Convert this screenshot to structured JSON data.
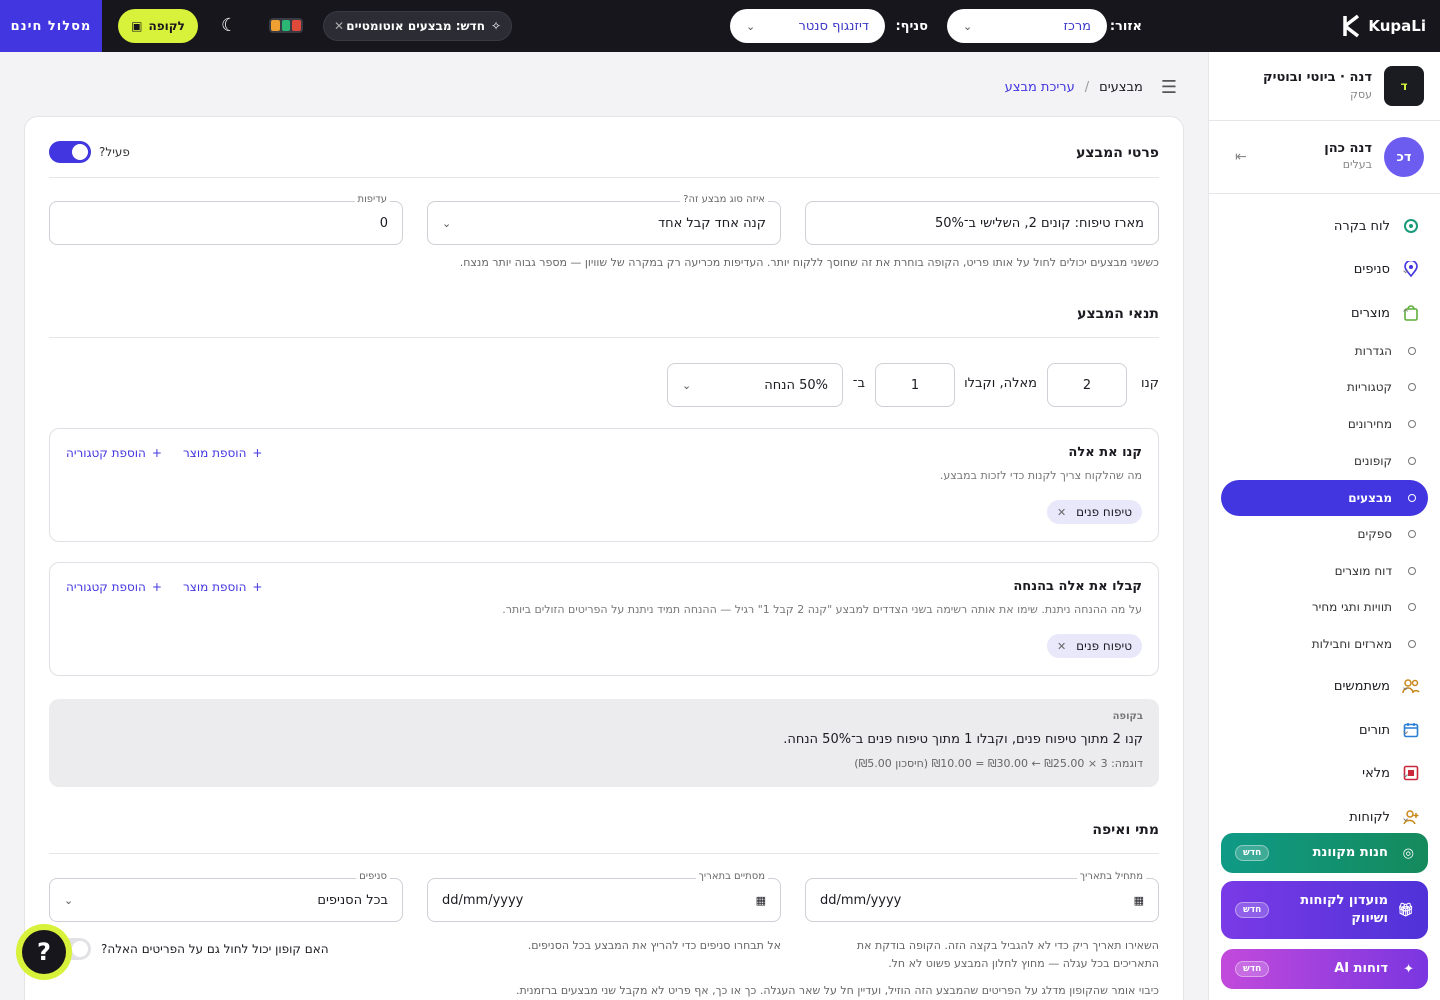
{
  "topbar": {
    "logo": "KupaLi",
    "area_label": "אזור:",
    "area_value": "מרכז",
    "branch_label": "סניף:",
    "branch_value": "דיזנגוף סנטר",
    "new_chip": "חדש: מבצעים אוטומטיים",
    "register_button": "לקופה",
    "free_route": "מסלול חינם",
    "theme_colors": [
      "#e04a3a",
      "#2bb673",
      "#f0a030"
    ]
  },
  "sidebar": {
    "business_avatar": "ד",
    "business_name": "דנה · ביוטי ובוטיק",
    "business_role": "עסק",
    "user_avatar": "דכ",
    "user_name": "דנה כהן",
    "user_role": "בעלים",
    "nav": [
      {
        "label": "לוח בקרה",
        "icon": "dashboard-icon"
      },
      {
        "label": "סניפים",
        "icon": "location-pin-icon"
      },
      {
        "label": "מוצרים",
        "icon": "shopping-bag-icon"
      },
      {
        "label": "משתמשים",
        "icon": "users-icon"
      },
      {
        "label": "תורים",
        "icon": "calendar-icon"
      },
      {
        "label": "מלאי",
        "icon": "inventory-icon"
      },
      {
        "label": "לקוחות",
        "icon": "customers-icon"
      }
    ],
    "products_sub": [
      "הגדרות",
      "קטגוריות",
      "מחירונים",
      "קופונים",
      "מבצעים",
      "ספקים",
      "דוח מוצרים",
      "תוויות ותגי מחיר",
      "מארזים וחבילות"
    ],
    "promos": [
      {
        "label": "חנות מקוונת",
        "badge": "חדש"
      },
      {
        "label": "מועדון לקוחות ושיווק",
        "badge": "חדש"
      },
      {
        "label": "דוחות AI",
        "badge": "חדש"
      }
    ]
  },
  "breadcrumb": {
    "root": "מבצעים",
    "separator": "/",
    "current": "עריכת מבצע"
  },
  "details": {
    "title": "פרטי המבצע",
    "active_label": "פעיל?",
    "name_value": "מארז טיפוח: קונים 2, השלישי ב־50%",
    "type_label": "איזה סוג מבצע זה?",
    "type_value": "קנה אחד קבל אחד",
    "priority_label": "עדיפות",
    "priority_value": "0",
    "help": "כששני מבצעים יכולים לחול על אותו פריט, הקופה בוחרת את זה שחוסך ללקוח יותר. העדיפות מכריעה רק במקרה של שוויון — מספר גבוה יותר מנצח."
  },
  "conditions": {
    "title": "תנאי המבצע",
    "buy_word": "קנו",
    "buy_qty": "2",
    "mid_text": "מאלה, וקבלו",
    "get_qty": "1",
    "at_word": "ב־",
    "discount_value": "50% הנחה",
    "buy_box": {
      "title": "קנו את אלה",
      "desc": "מה שהלקוח צריך לקנות כדי לזכות במבצע.",
      "add_product": "הוספת מוצר",
      "add_category": "הוספת קטגוריה",
      "tag": "טיפוח פנים"
    },
    "get_box": {
      "title": "קבלו את אלה בהנחה",
      "desc": "על מה ההנחה ניתנת. שימו את אותה רשימה בשני הצדדים למבצע \"קנה 2 קבל 1\" רגיל — ההנחה תמיד ניתנת על הפריטים הזולים ביותר.",
      "add_product": "הוספת מוצר",
      "add_category": "הוספת קטגוריה",
      "tag": "טיפוח פנים"
    },
    "summary": {
      "label": "בקופה",
      "text": "קנו 2 מתוך טיפוח פנים, וקבלו 1 מתוך טיפוח פנים ב־50% הנחה.",
      "example": "דוגמה: 3 × ‎₪10.00 = ₪30.00 ← ₪25.00 (חיסכון ₪5.00)"
    }
  },
  "when": {
    "title": "מתי ואיפה",
    "start_label": "מתחיל בתאריך",
    "start_value": "dd/mm/yyyy",
    "end_label": "מסתיים בתאריך",
    "end_value": "dd/mm/yyyy",
    "branches_label": "סניפים",
    "branches_value": "בכל הסניפים",
    "help_dates_1": "השאירו תאריך ריק כדי לא להגביל בקצה הזה. הקופה בודקת את",
    "help_dates_2": "התאריכים בכל עגלה — מחוץ לחלון המבצע פשוט לא חל.",
    "help_branches": "אל תבחרו סניפים כדי להריץ את המבצע בכל הסניפים.",
    "coupon_question": "האם קופון יכול לחול גם על הפריטים האלה?",
    "coupon_help": "כיבוי אומר שהקופון מדלג על הפריטים שהמבצע הזה הוזיל, ועדיין חל על שאר העגלה. כך או כך, אף פריט לא מקבל שני מבצעים ברזמנית."
  },
  "help_button": "?"
}
